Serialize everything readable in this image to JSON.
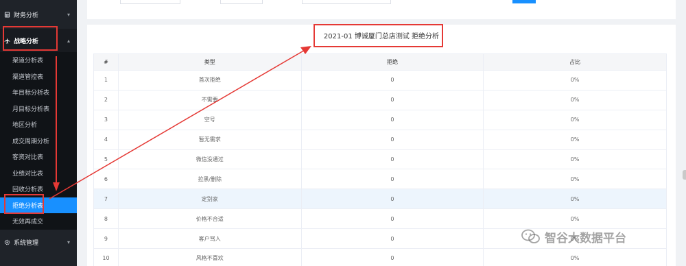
{
  "sidebar": {
    "top_item": {
      "label": "财务分析",
      "icon": "calculator-icon"
    },
    "group": {
      "label": "战略分析",
      "icon": "airplane-icon"
    },
    "items": [
      {
        "label": "渠道分析表"
      },
      {
        "label": "渠道管控表"
      },
      {
        "label": "年目标分析表"
      },
      {
        "label": "月目标分析表"
      },
      {
        "label": "地区分析"
      },
      {
        "label": "成交周期分析"
      },
      {
        "label": "客资对比表"
      },
      {
        "label": "业绩对比表"
      },
      {
        "label": "回收分析表"
      },
      {
        "label": "拒绝分析表"
      },
      {
        "label": "无效再成交"
      }
    ],
    "bottom_item": {
      "label": "系统管理",
      "icon": "gear-icon"
    }
  },
  "report": {
    "title": "2021-01 博诚厦门总店测试 拒绝分析",
    "columns": [
      "#",
      "类型",
      "拒绝",
      "占比"
    ],
    "rows": [
      {
        "num": "1",
        "type": "首次拒绝",
        "rejected": "0",
        "ratio": "0%"
      },
      {
        "num": "2",
        "type": "不需要",
        "rejected": "0",
        "ratio": "0%"
      },
      {
        "num": "3",
        "type": "空号",
        "rejected": "0",
        "ratio": "0%"
      },
      {
        "num": "4",
        "type": "暂无需求",
        "rejected": "0",
        "ratio": "0%"
      },
      {
        "num": "5",
        "type": "微信没通过",
        "rejected": "0",
        "ratio": "0%"
      },
      {
        "num": "6",
        "type": "拉黑/删除",
        "rejected": "0",
        "ratio": "0%"
      },
      {
        "num": "7",
        "type": "定别家",
        "rejected": "0",
        "ratio": "0%"
      },
      {
        "num": "8",
        "type": "价格不合适",
        "rejected": "0",
        "ratio": "0%"
      },
      {
        "num": "9",
        "type": "客户骂人",
        "rejected": "0",
        "ratio": "0%"
      },
      {
        "num": "10",
        "type": "风格不喜欢",
        "rejected": "0",
        "ratio": "0%"
      }
    ]
  },
  "watermark": {
    "text": "智谷大数据平台",
    "icon": "wechat-icon"
  },
  "colors": {
    "accent": "#1890ff",
    "sidebar_bg": "#1f2329",
    "annotation": "#e53935"
  }
}
